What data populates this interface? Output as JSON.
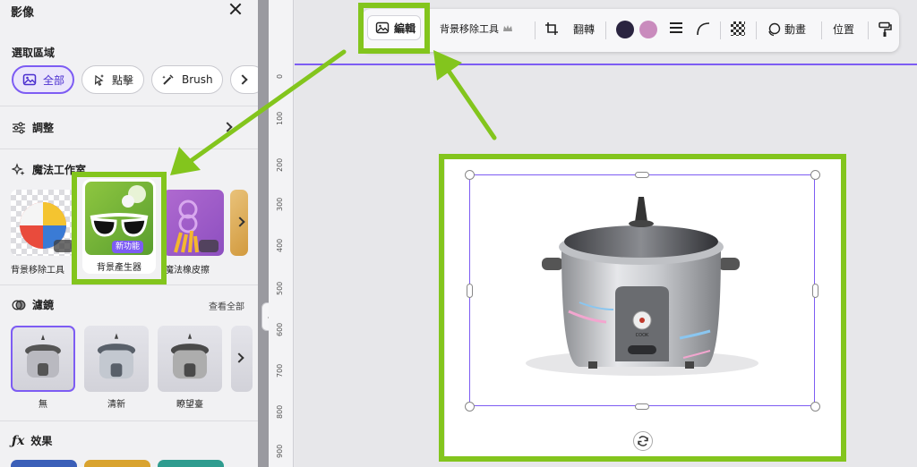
{
  "panel": {
    "title": "影像",
    "select_area": {
      "label": "選取區域",
      "options": [
        "全部",
        "點擊",
        "Brush"
      ]
    },
    "adjust_label": "調整",
    "magic_studio": {
      "label": "魔法工作室",
      "tools": [
        {
          "label": "背景移除工具"
        },
        {
          "label": "背景產生器",
          "badge": "新功能"
        },
        {
          "label": "魔法橡皮擦"
        }
      ]
    },
    "filters": {
      "label": "濾鏡",
      "see_all": "查看全部",
      "items": [
        "無",
        "清新",
        "瞭望臺"
      ]
    },
    "effects_label": "效果"
  },
  "ruler": {
    "marks": [
      "0",
      "100",
      "200",
      "300",
      "400",
      "500",
      "600",
      "700",
      "800",
      "900"
    ]
  },
  "toolbar": {
    "edit_label": "編輯",
    "bg_remove_label": "背景移除工具",
    "flip_label": "翻轉",
    "animate_label": "動畫",
    "position_label": "位置"
  },
  "colors": {
    "accent": "#7d5cf3",
    "highlight": "#83c51d",
    "swatch_dark": "#2a2440",
    "swatch_pink": "#c98bbd"
  },
  "canvas": {
    "image_text": "COOK"
  }
}
